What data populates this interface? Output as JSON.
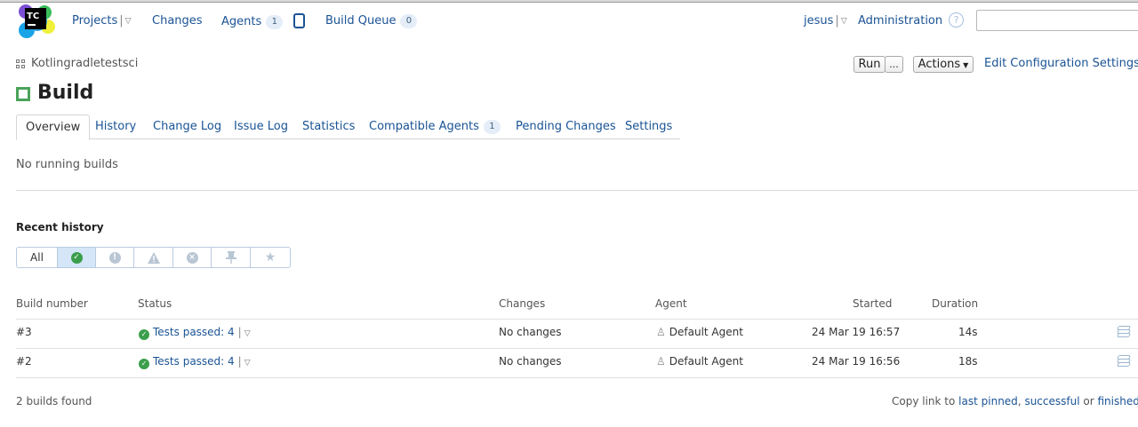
{
  "header": {
    "logo_text": "TC",
    "nav": {
      "projects": "Projects",
      "changes": "Changes",
      "agents": "Agents",
      "agents_count": "1",
      "build_queue": "Build Queue",
      "build_queue_count": "0"
    },
    "user": "jesus",
    "administration": "Administration",
    "help_glyph": "?",
    "search_value": ""
  },
  "breadcrumb": {
    "project": "Kotlingradletestsci"
  },
  "toolbar": {
    "run": "Run",
    "run_more": "...",
    "actions": "Actions",
    "edit_settings": "Edit Configuration Settings"
  },
  "page": {
    "title": "Build"
  },
  "tabs": {
    "overview": "Overview",
    "history": "History",
    "change_log": "Change Log",
    "issue_log": "Issue Log",
    "statistics": "Statistics",
    "compatible_agents": "Compatible Agents",
    "compatible_agents_count": "1",
    "pending_changes": "Pending Changes",
    "settings": "Settings"
  },
  "running": {
    "text": "No running builds"
  },
  "recent": {
    "heading": "Recent history",
    "filters": {
      "all": "All",
      "icons": [
        "success-icon",
        "failed-icon",
        "warning-icon",
        "cancelled-icon",
        "pinned-icon",
        "favorite-icon"
      ],
      "selected": "success-icon"
    }
  },
  "table": {
    "headers": {
      "build_number": "Build number",
      "status": "Status",
      "changes": "Changes",
      "agent": "Agent",
      "started": "Started",
      "duration": "Duration"
    },
    "rows": [
      {
        "number": "#3",
        "status": "Tests passed: 4",
        "changes": "No changes",
        "agent": "Default Agent",
        "started": "24 Mar 19 16:57",
        "duration": "14s"
      },
      {
        "number": "#2",
        "status": "Tests passed: 4",
        "changes": "No changes",
        "agent": "Default Agent",
        "started": "24 Mar 19 16:56",
        "duration": "18s"
      }
    ]
  },
  "footer": {
    "found": "2 builds found",
    "copy_prefix": "Copy link to",
    "last_pinned": "last pinned",
    "comma": ",",
    "successful": "successful",
    "or": "or",
    "finished": "finished b"
  },
  "colors": {
    "accent": "#1a5394",
    "success": "#3b9e4b",
    "selected_filter": "#d4e6f7"
  }
}
